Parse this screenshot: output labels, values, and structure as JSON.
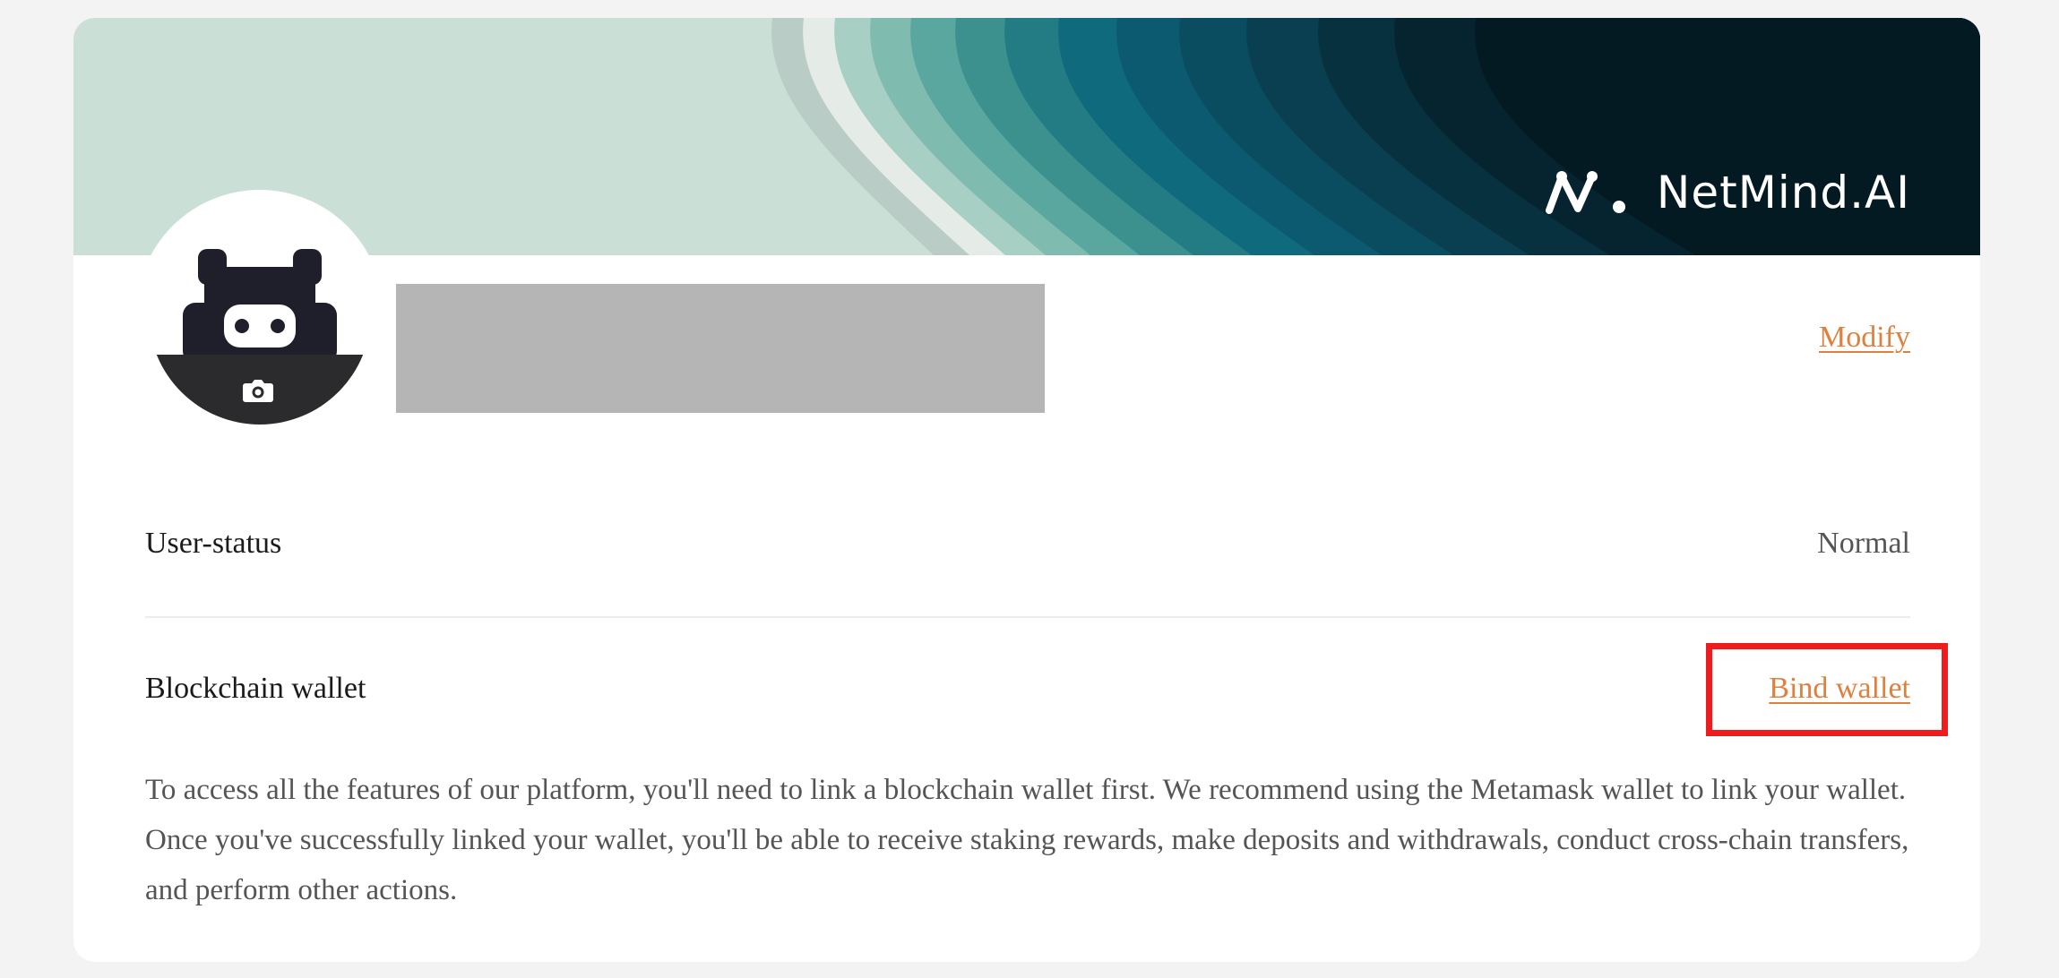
{
  "banner": {
    "brand_name": "NetMind.AI",
    "logo_icon": "netmind-logo-icon"
  },
  "profile": {
    "avatar_icon": "robot-avatar-icon",
    "upload_icon": "camera-icon",
    "modify_label": "Modify"
  },
  "user_status": {
    "label": "User-status",
    "value": "Normal"
  },
  "wallet": {
    "label": "Blockchain wallet",
    "bind_label": "Bind wallet",
    "description": "To access all the features of our platform, you'll need to link a blockchain wallet first. We recommend using the Metamask wallet to link your wallet. Once you've successfully linked your wallet, you'll be able to receive staking rewards, make deposits and withdrawals, conduct cross-chain transfers, and perform other actions."
  },
  "colors": {
    "link": "#e0803f",
    "highlight_box": "#ee1c1c",
    "banner_light": "#cadfd6",
    "banner_dark": "#02141a"
  }
}
